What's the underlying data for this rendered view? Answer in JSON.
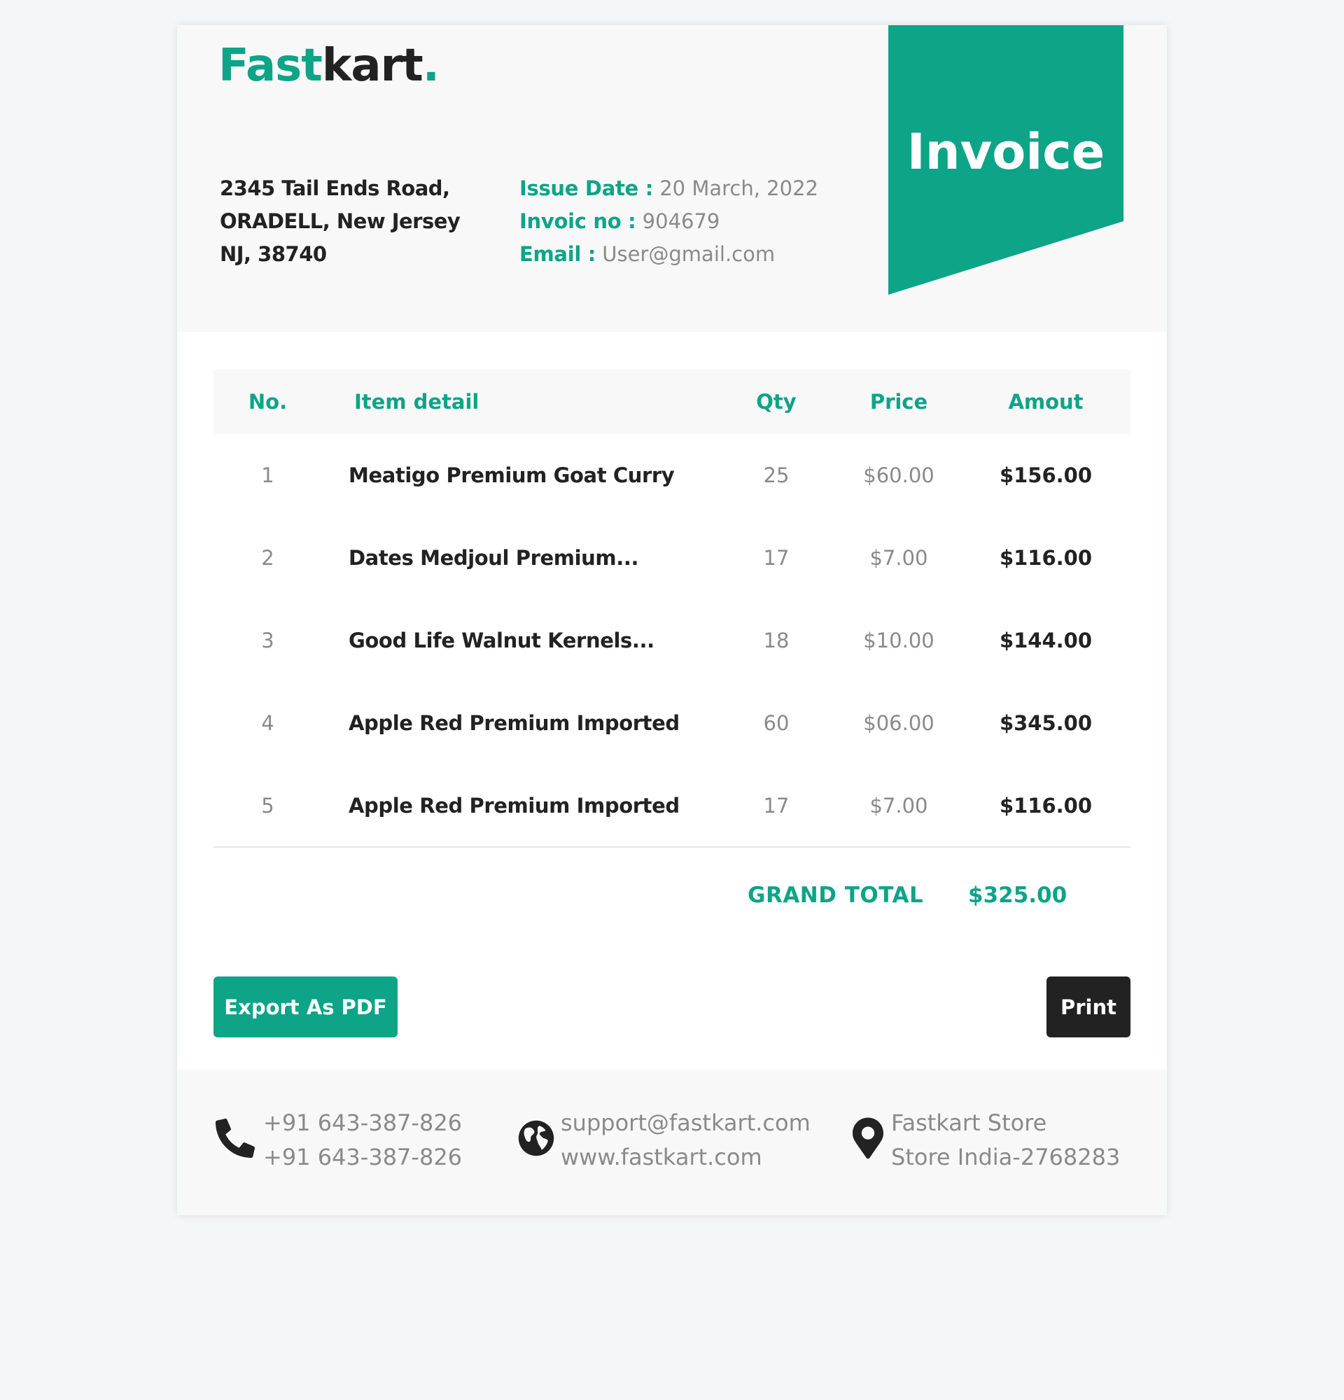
{
  "brand": {
    "logo_part1": "Fast",
    "logo_part2": "kart",
    "logo_dot": ".",
    "accent_color": "#0da487",
    "dark_color": "#222222"
  },
  "address": {
    "line1": "2345 Tail Ends Road,",
    "line2": "ORADELL, New Jersey",
    "line3": "NJ, 38740"
  },
  "meta": {
    "issue_date_label": "Issue Date :",
    "issue_date_value": "20 March, 2022",
    "invoice_no_label": "Invoic no :",
    "invoice_no_value": "904679",
    "email_label": "Email :",
    "email_value": "User@gmail.com"
  },
  "ribbon": {
    "title": "Invoice"
  },
  "table": {
    "headers": {
      "no": "No.",
      "item": "Item detail",
      "qty": "Qty",
      "price": "Price",
      "amount": "Amout"
    },
    "rows": [
      {
        "no": "1",
        "item": "Meatigo Premium Goat Curry",
        "qty": "25",
        "price": "$60.00",
        "amount": "$156.00"
      },
      {
        "no": "2",
        "item": "Dates Medjoul Premium...",
        "qty": "17",
        "price": "$7.00",
        "amount": "$116.00"
      },
      {
        "no": "3",
        "item": "Good Life Walnut Kernels...",
        "qty": "18",
        "price": "$10.00",
        "amount": "$144.00"
      },
      {
        "no": "4",
        "item": "Apple Red Premium Imported",
        "qty": "60",
        "price": "$06.00",
        "amount": "$345.00"
      },
      {
        "no": "5",
        "item": "Apple Red Premium Imported",
        "qty": "17",
        "price": "$7.00",
        "amount": "$116.00"
      }
    ]
  },
  "totals": {
    "grand_total_label": "GRAND TOTAL",
    "grand_total_value": "$325.00"
  },
  "actions": {
    "export_label": "Export As PDF",
    "print_label": "Print"
  },
  "footer": {
    "phone": {
      "icon": "phone-icon",
      "line1": "+91 643-387-826",
      "line2": "+91 643-387-826"
    },
    "web": {
      "icon": "globe-icon",
      "line1": "support@fastkart.com",
      "line2": "www.fastkart.com"
    },
    "location": {
      "icon": "map-pin-icon",
      "line1": "Fastkart Store",
      "line2": "Store India-2768283"
    }
  }
}
